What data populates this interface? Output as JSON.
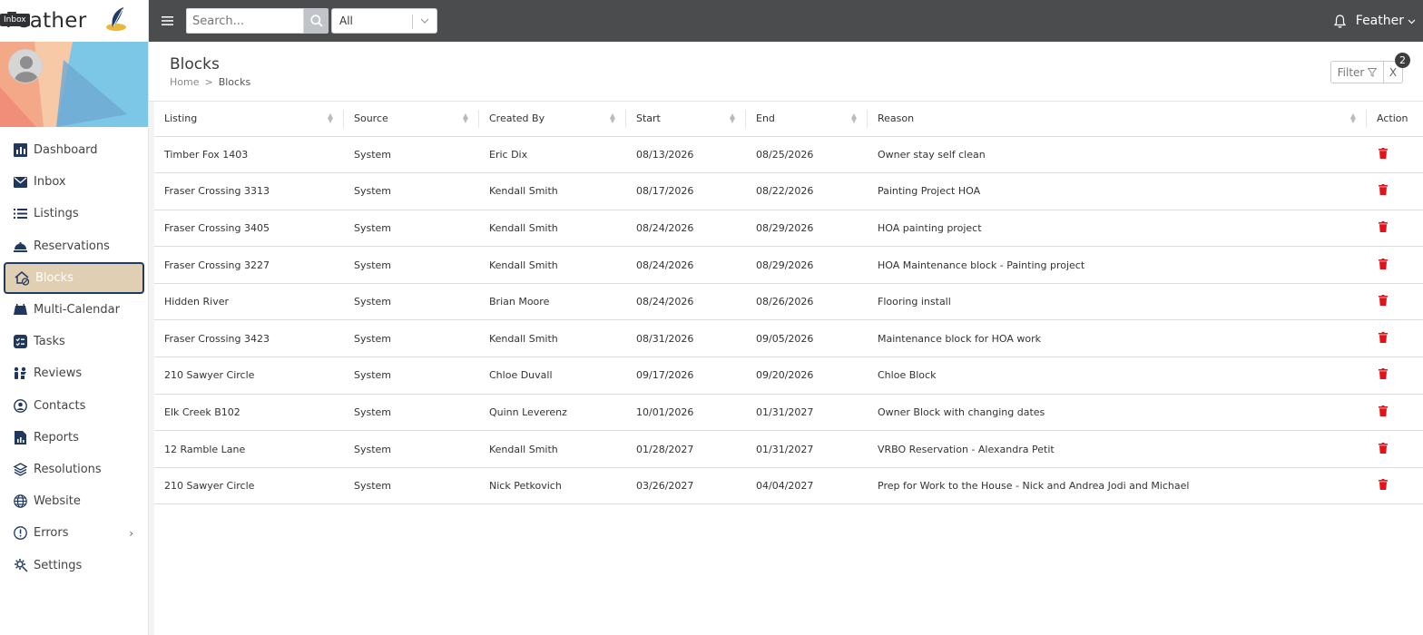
{
  "brand": {
    "name": "Feather",
    "tooltip": "Inbox"
  },
  "sidebar": {
    "items": [
      {
        "label": "Dashboard",
        "icon": "chart-bar-icon",
        "active": false
      },
      {
        "label": "Inbox",
        "icon": "envelope-icon",
        "active": false
      },
      {
        "label": "Listings",
        "icon": "list-icon",
        "active": false
      },
      {
        "label": "Reservations",
        "icon": "bell-concierge-icon",
        "active": false
      },
      {
        "label": "Blocks",
        "icon": "house-block-icon",
        "active": true
      },
      {
        "label": "Multi-Calendar",
        "icon": "calendar-icon",
        "active": false
      },
      {
        "label": "Tasks",
        "icon": "tasks-icon",
        "active": false
      },
      {
        "label": "Reviews",
        "icon": "reviews-icon",
        "active": false
      },
      {
        "label": "Contacts",
        "icon": "contact-icon",
        "active": false
      },
      {
        "label": "Reports",
        "icon": "report-icon",
        "active": false
      },
      {
        "label": "Resolutions",
        "icon": "layers-icon",
        "active": false
      },
      {
        "label": "Website",
        "icon": "globe-icon",
        "active": false
      },
      {
        "label": "Errors",
        "icon": "exclamation-icon",
        "active": false
      },
      {
        "label": "Settings",
        "icon": "gear-icon",
        "active": false
      }
    ]
  },
  "topbar": {
    "search_placeholder": "Search...",
    "select_value": "All",
    "user_name": "Feather"
  },
  "page": {
    "title": "Blocks",
    "breadcrumb_home": "Home",
    "breadcrumb_sep": ">",
    "breadcrumb_current": "Blocks",
    "filter_label": "Filter",
    "clear_label": "X",
    "filter_count": "2"
  },
  "table": {
    "columns": [
      "Listing",
      "Source",
      "Created By",
      "Start",
      "End",
      "Reason",
      "Action"
    ],
    "rows": [
      {
        "listing": "Timber Fox 1403",
        "source": "System",
        "created_by": "Eric Dix",
        "start": "08/13/2026",
        "end": "08/25/2026",
        "reason": "Owner stay self clean"
      },
      {
        "listing": "Fraser Crossing 3313",
        "source": "System",
        "created_by": "Kendall Smith",
        "start": "08/17/2026",
        "end": "08/22/2026",
        "reason": "Painting Project HOA"
      },
      {
        "listing": "Fraser Crossing 3405",
        "source": "System",
        "created_by": "Kendall Smith",
        "start": "08/24/2026",
        "end": "08/29/2026",
        "reason": "HOA painting project"
      },
      {
        "listing": "Fraser Crossing 3227",
        "source": "System",
        "created_by": "Kendall Smith",
        "start": "08/24/2026",
        "end": "08/29/2026",
        "reason": "HOA Maintenance block - Painting project"
      },
      {
        "listing": "Hidden River",
        "source": "System",
        "created_by": "Brian Moore",
        "start": "08/24/2026",
        "end": "08/26/2026",
        "reason": "Flooring install"
      },
      {
        "listing": "Fraser Crossing 3423",
        "source": "System",
        "created_by": "Kendall Smith",
        "start": "08/31/2026",
        "end": "09/05/2026",
        "reason": "Maintenance block for HOA work"
      },
      {
        "listing": "210 Sawyer Circle",
        "source": "System",
        "created_by": "Chloe Duvall",
        "start": "09/17/2026",
        "end": "09/20/2026",
        "reason": "Chloe Block"
      },
      {
        "listing": "Elk Creek B102",
        "source": "System",
        "created_by": "Quinn Leverenz",
        "start": "10/01/2026",
        "end": "01/31/2027",
        "reason": "Owner Block with changing dates"
      },
      {
        "listing": "12 Ramble Lane",
        "source": "System",
        "created_by": "Kendall Smith",
        "start": "01/28/2027",
        "end": "01/31/2027",
        "reason": "VRBO Reservation - Alexandra Petit"
      },
      {
        "listing": "210 Sawyer Circle",
        "source": "System",
        "created_by": "Nick Petkovich",
        "start": "03/26/2027",
        "end": "04/04/2027",
        "reason": "Prep for Work to the House - Nick and Andrea Jodi and Michael"
      }
    ]
  },
  "colors": {
    "topbar": "#4b4c4d",
    "active_nav_bg": "#e0cfb3",
    "active_nav_border": "#1f3a64",
    "icon_navy": "#20385c",
    "trash_red": "#e0131b"
  }
}
